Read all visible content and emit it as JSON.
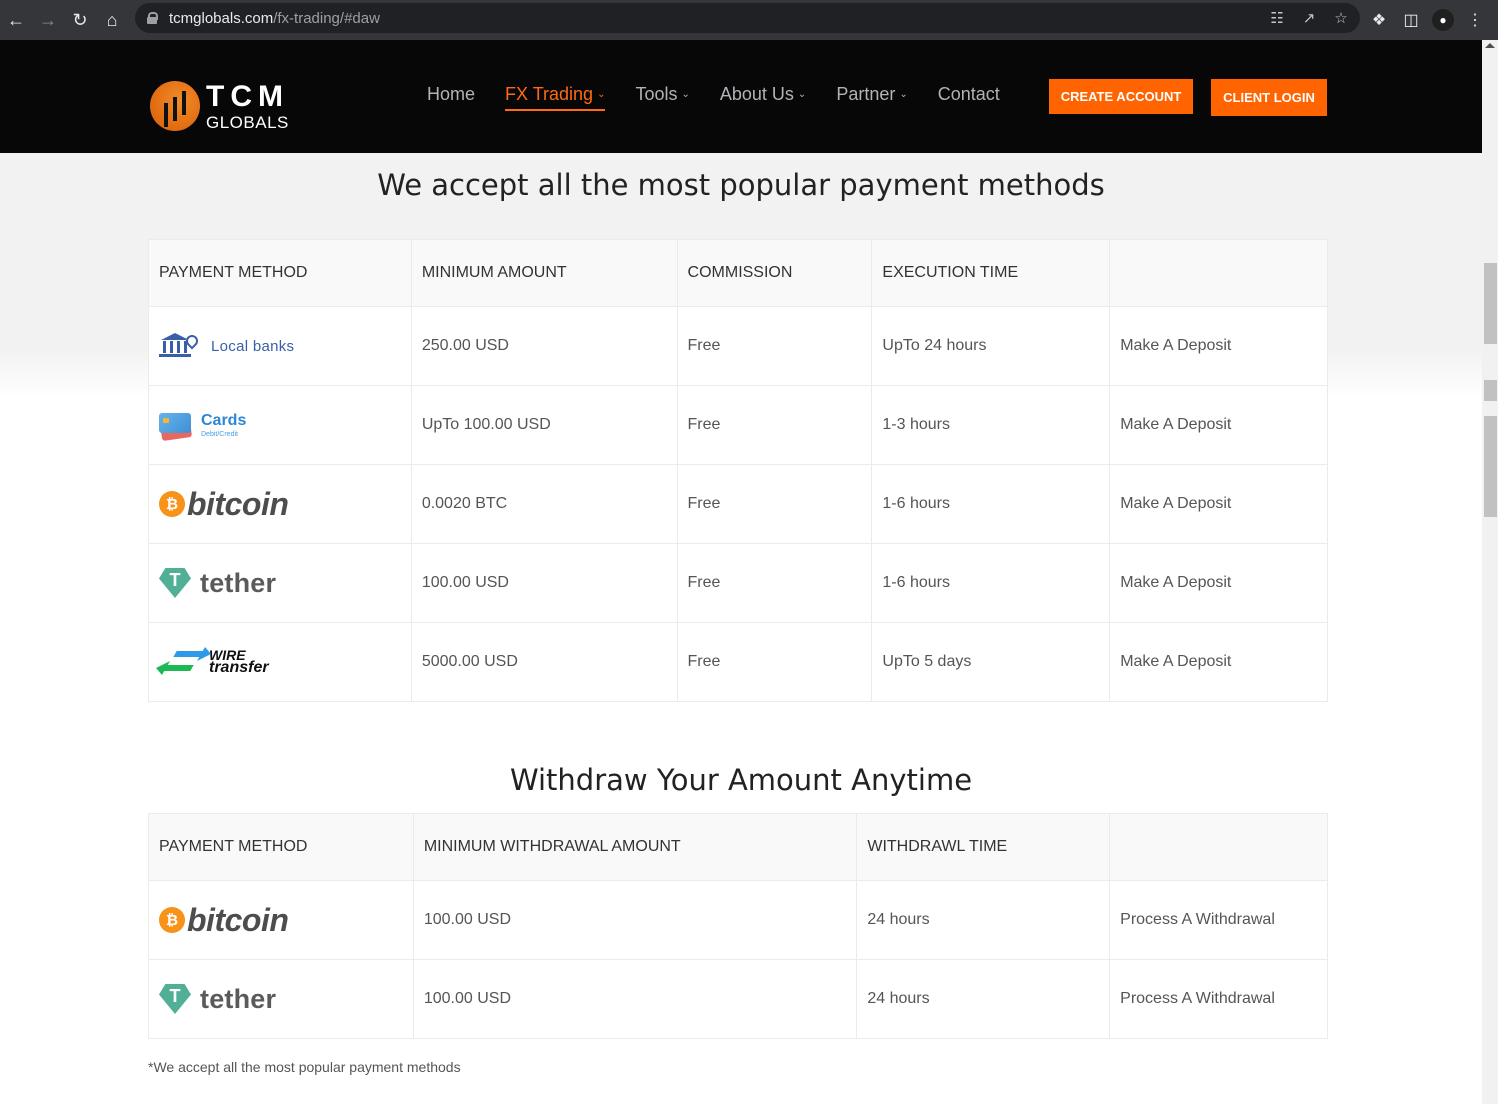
{
  "browser": {
    "url_host": "tcmglobals.com",
    "url_path": "/fx-trading/#daw",
    "icons": {
      "back": "arrow-left-icon",
      "forward": "arrow-right-icon",
      "reload": "reload-icon",
      "home": "home-icon",
      "lock": "lock-icon",
      "translate": "translate-icon",
      "share": "share-icon",
      "bookmark": "star-icon",
      "extensions": "puzzle-icon",
      "sidepanel": "side-panel-icon",
      "profile": "profile-icon",
      "menu": "kebab-menu-icon"
    }
  },
  "header": {
    "logo_main": "TCM",
    "logo_sub": "GLOBALS",
    "nav": [
      {
        "label": "Home",
        "has_dropdown": false
      },
      {
        "label": "FX Trading",
        "has_dropdown": true,
        "active": true
      },
      {
        "label": "Tools",
        "has_dropdown": true
      },
      {
        "label": "About Us",
        "has_dropdown": true
      },
      {
        "label": "Partner",
        "has_dropdown": true
      },
      {
        "label": "Contact",
        "has_dropdown": false
      }
    ],
    "create_account_label": "CREATE ACCOUNT",
    "client_login_label": "CLIENT LOGIN",
    "accent_color": "#ff6400"
  },
  "deposit": {
    "title": "We accept all the most popular payment methods",
    "headers": [
      "PAYMENT METHOD",
      "MINIMUM AMOUNT",
      "COMMISSION",
      "EXECUTION TIME",
      ""
    ],
    "rows": [
      {
        "method": "Local banks",
        "logo": "bank-icon",
        "min_amount": "250.00 USD",
        "commission": "Free",
        "execution_time": "UpTo 24 hours",
        "action": "Make A Deposit"
      },
      {
        "method": "Cards",
        "method_sub": "Debit/Credit",
        "logo": "credit-card-icon",
        "min_amount": "UpTo 100.00 USD",
        "commission": "Free",
        "execution_time": "1-3 hours",
        "action": "Make A Deposit"
      },
      {
        "method": "bitcoin",
        "logo": "bitcoin-icon",
        "min_amount": "0.0020 BTC",
        "commission": "Free",
        "execution_time": "1-6 hours",
        "action": "Make A Deposit"
      },
      {
        "method": "tether",
        "logo": "tether-icon",
        "min_amount": "100.00 USD",
        "commission": "Free",
        "execution_time": "1-6 hours",
        "action": "Make A Deposit"
      },
      {
        "method_line1": "WIRE",
        "method_line2": "transfer",
        "logo": "wire-transfer-icon",
        "min_amount": "5000.00 USD",
        "commission": "Free",
        "execution_time": "UpTo 5 days",
        "action": "Make A Deposit"
      }
    ]
  },
  "withdraw": {
    "title": "Withdraw Your Amount Anytime",
    "headers": [
      "PAYMENT METHOD",
      "MINIMUM WITHDRAWAL AMOUNT",
      "WITHDRAWL TIME",
      ""
    ],
    "rows": [
      {
        "method": "bitcoin",
        "logo": "bitcoin-icon",
        "min_amount": "100.00 USD",
        "time": "24 hours",
        "action": "Process A Withdrawal"
      },
      {
        "method": "tether",
        "logo": "tether-icon",
        "min_amount": "100.00 USD",
        "time": "24 hours",
        "action": "Process A Withdrawal"
      }
    ]
  },
  "footnote": "*We accept all the most popular payment methods"
}
